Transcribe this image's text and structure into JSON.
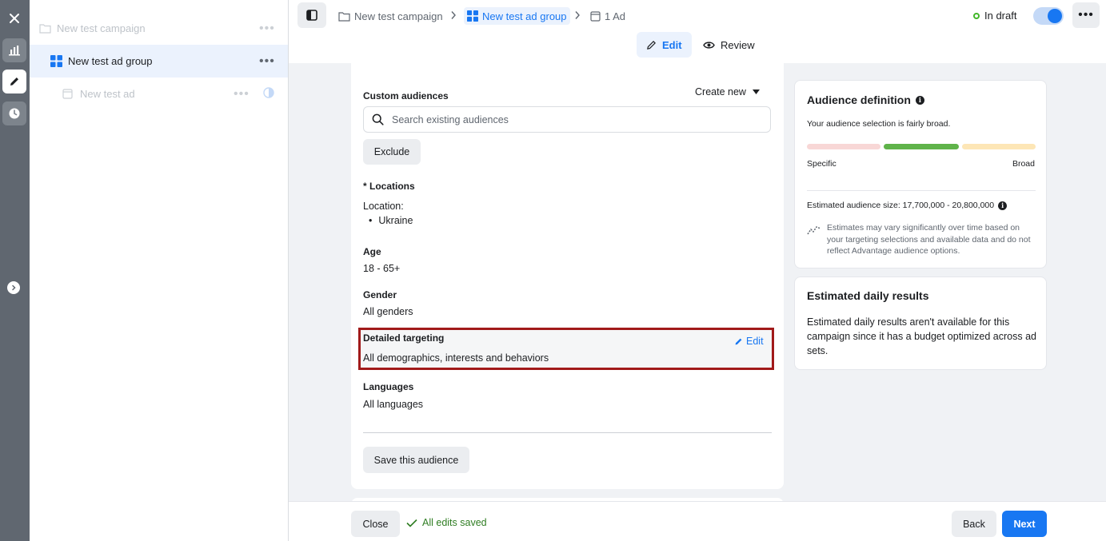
{
  "tree": {
    "campaign": "New test campaign",
    "ad_group": "New test ad group",
    "ad": "New test ad"
  },
  "header": {
    "breadcrumb_campaign": "New test campaign",
    "breadcrumb_ad_group": "New test ad group",
    "breadcrumb_ad": "1 Ad",
    "status": "In draft",
    "tab_edit": "Edit",
    "tab_review": "Review"
  },
  "form": {
    "custom_audiences_title": "Custom audiences",
    "create_new": "Create new",
    "search_placeholder": "Search existing audiences",
    "exclude": "Exclude",
    "locations_title": "* Locations",
    "location_label": "Location:",
    "location_value": "Ukraine",
    "age_title": "Age",
    "age_value": "18 - 65+",
    "gender_title": "Gender",
    "gender_value": "All genders",
    "detailed_title": "Detailed targeting",
    "detailed_value": "All demographics, interests and behaviors",
    "detailed_edit": "Edit",
    "languages_title": "Languages",
    "languages_value": "All languages",
    "save_audience": "Save this audience"
  },
  "audience": {
    "title": "Audience definition",
    "description": "Your audience selection is fairly broad.",
    "specific": "Specific",
    "broad": "Broad",
    "size": "Estimated audience size: 17,700,000 - 20,800,000",
    "note": "Estimates may vary significantly over time based on your targeting selections and available data and do not reflect Advantage audience options."
  },
  "estimated": {
    "title": "Estimated daily results",
    "description": "Estimated daily results aren't available for this campaign since it has a budget optimized across ad sets."
  },
  "footer": {
    "close": "Close",
    "saved": "All edits saved",
    "back": "Back",
    "next": "Next"
  },
  "colors": {
    "accent": "#1877f2",
    "highlight_border": "#a11a1a",
    "success": "#2f7d22"
  }
}
